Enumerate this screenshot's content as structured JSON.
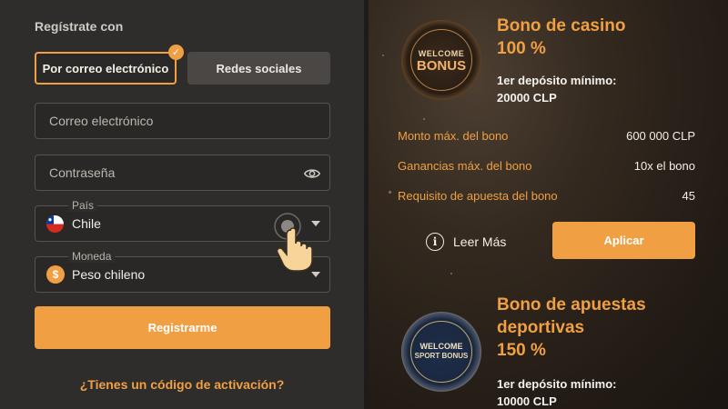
{
  "register": {
    "heading": "Regístrate con",
    "tabs": {
      "email": "Por correo electrónico",
      "social": "Redes sociales"
    },
    "email_placeholder": "Correo electrónico",
    "password_placeholder": "Contraseña",
    "country": {
      "label": "País",
      "value": "Chile"
    },
    "currency": {
      "label": "Moneda",
      "value": "Peso chileno",
      "symbol": "$"
    },
    "submit_label": "Registrarme",
    "activation_link": "¿Tienes un código de activación?"
  },
  "bonuses": [
    {
      "badge_line1": "WELCOME",
      "badge_line2": "BONUS",
      "title_line1": "Bono de casino",
      "title_line2": "100 %",
      "min_deposit_label": "1er depósito mínimo:",
      "min_deposit_value": "20000 CLP",
      "details": [
        {
          "label": "Monto máx. del bono",
          "value": "600 000 CLP"
        },
        {
          "label": "Ganancias máx. del bono",
          "value": "10x el bono"
        },
        {
          "label": "Requisito de apuesta del bono",
          "value": "45"
        }
      ],
      "read_more": "Leer Más",
      "apply_label": "Aplicar"
    },
    {
      "badge_line1": "WELCOME",
      "badge_line2": "SPORT BONUS",
      "title_line1": "Bono de apuestas",
      "title_line2": "deportivas",
      "title_line3": "150 %",
      "min_deposit_label": "1er depósito mínimo:",
      "min_deposit_value": "10000 CLP"
    }
  ],
  "colors": {
    "accent": "#f0a043",
    "panel": "#2f2d2b",
    "field_border": "#56524e"
  }
}
